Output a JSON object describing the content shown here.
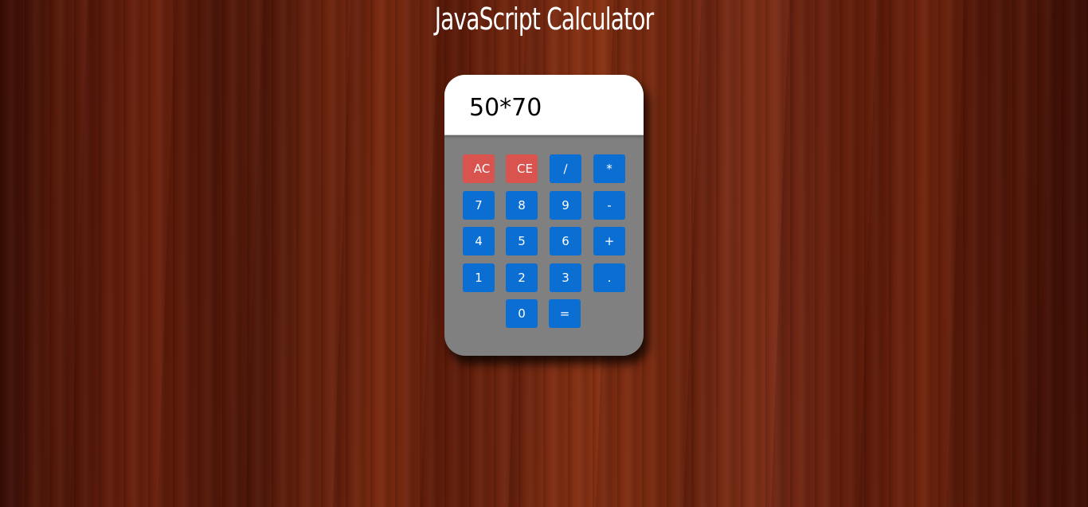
{
  "page": {
    "title": "JavaScript Calculator"
  },
  "calculator": {
    "display": "50*70",
    "buttons": {
      "ac": "AC",
      "ce": "CE",
      "divide": "/",
      "multiply": "*",
      "seven": "7",
      "eight": "8",
      "nine": "9",
      "minus": "-",
      "four": "4",
      "five": "5",
      "six": "6",
      "plus": "+",
      "one": "1",
      "two": "2",
      "three": "3",
      "decimal": ".",
      "zero": "0",
      "equals": "="
    }
  },
  "colors": {
    "operator_blue": "#0a6ed3",
    "clear_red": "#d9534f",
    "body_gray": "#808080",
    "display_white": "#ffffff"
  }
}
